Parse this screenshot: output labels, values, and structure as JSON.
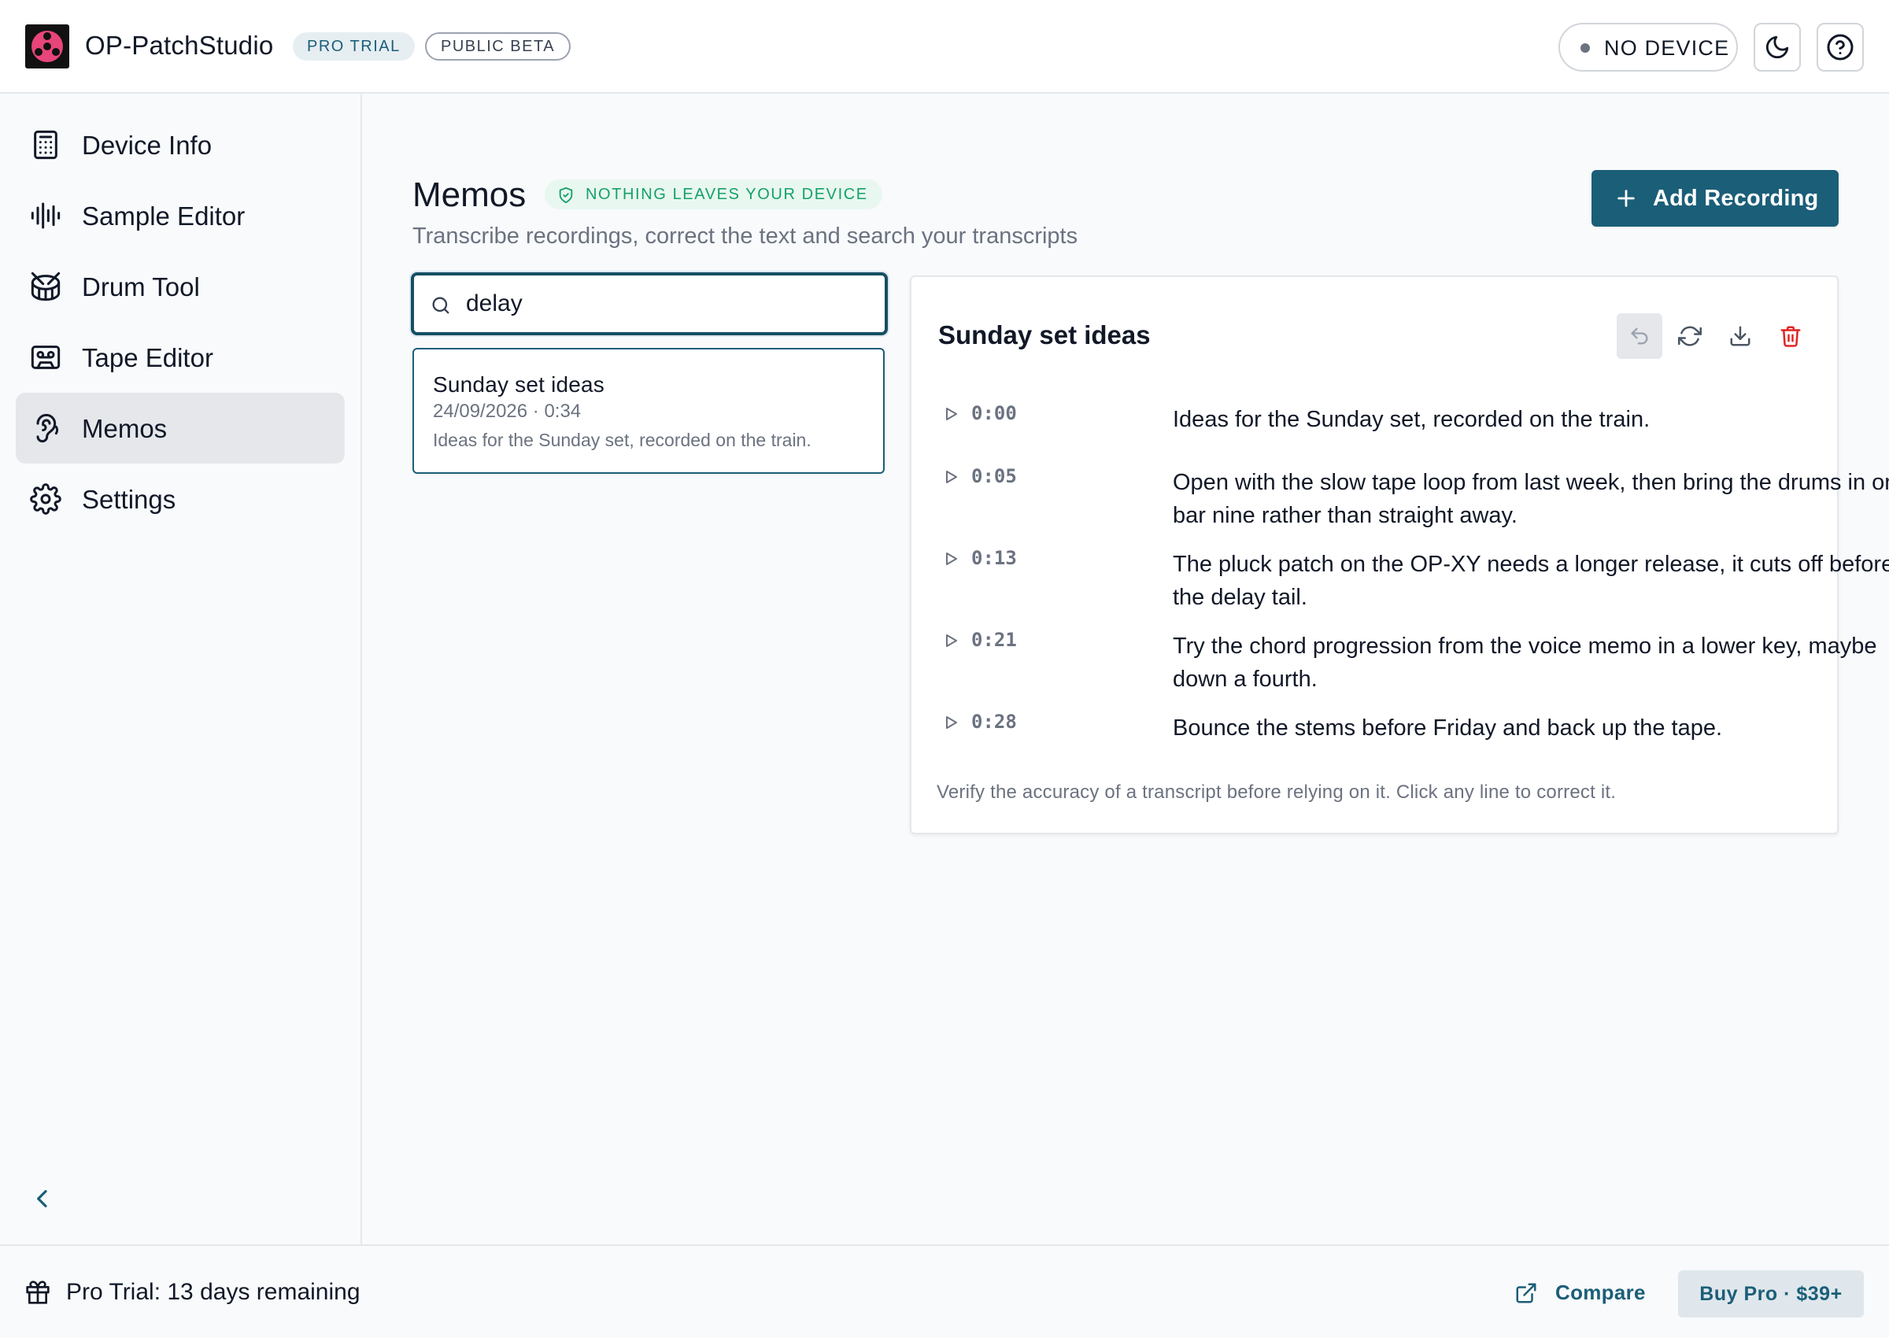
{
  "header": {
    "app_name": "OP-PatchStudio",
    "badge_pro": "PRO TRIAL",
    "badge_beta": "PUBLIC BETA",
    "device_status": "NO DEVICE",
    "icons": {
      "logo": "app-logo",
      "theme": "moon-icon",
      "help": "help-circle-icon"
    }
  },
  "sidebar": {
    "items": [
      {
        "label": "Device Info",
        "icon": "calculator-icon",
        "active": false
      },
      {
        "label": "Sample Editor",
        "icon": "waveform-icon",
        "active": false
      },
      {
        "label": "Drum Tool",
        "icon": "drum-icon",
        "active": false
      },
      {
        "label": "Tape Editor",
        "icon": "cassette-icon",
        "active": false
      },
      {
        "label": "Memos",
        "icon": "ear-icon",
        "active": true
      },
      {
        "label": "Settings",
        "icon": "gear-icon",
        "active": false
      }
    ],
    "collapse_icon": "chevron-left-icon"
  },
  "main": {
    "title": "Memos",
    "privacy_badge": "NOTHING LEAVES YOUR DEVICE",
    "subtitle": "Transcribe recordings, correct the text and search your transcripts",
    "add_button": "Add Recording",
    "search": {
      "value": "delay",
      "icon": "search-icon"
    },
    "memos": [
      {
        "title": "Sunday set ideas",
        "meta": "24/09/2026 · 0:34",
        "preview": "Ideas for the Sunday set, recorded on the train."
      }
    ],
    "detail": {
      "title": "Sunday set ideas",
      "actions": [
        "undo-icon",
        "refresh-icon",
        "download-icon",
        "trash-icon"
      ],
      "segments": [
        {
          "time": "0:00",
          "text": "Ideas for the Sunday set, recorded on the train."
        },
        {
          "time": "0:05",
          "text": "Open with the slow tape loop from last week, then bring the drums in on bar nine rather than straight away."
        },
        {
          "time": "0:13",
          "text": "The pluck patch on the OP-XY needs a longer release, it cuts off before the delay tail."
        },
        {
          "time": "0:21",
          "text": "Try the chord progression from the voice memo in a lower key, maybe down a fourth."
        },
        {
          "time": "0:28",
          "text": "Bounce the stems before Friday and back up the tape."
        }
      ],
      "disclaimer": "Verify the accuracy of a transcript before relying on it. Click any line to correct it."
    }
  },
  "footer": {
    "trial_text": "Pro Trial: 13 days remaining",
    "compare_label": "Compare",
    "buy_label": "Buy Pro · $39+"
  },
  "colors": {
    "accent": "#1b5e78",
    "success": "#14a06a",
    "danger": "#e02424",
    "logo_pink": "#e8457a"
  }
}
